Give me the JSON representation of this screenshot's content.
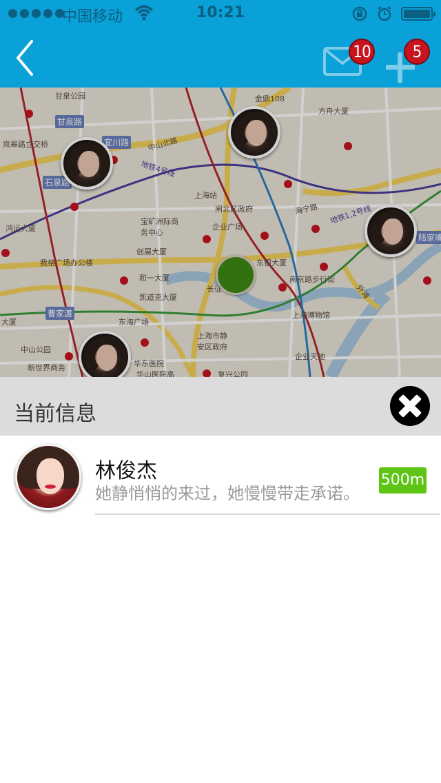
{
  "status_bar": {
    "carrier": "中国移动",
    "time": "10:21"
  },
  "nav": {
    "mail_badge": "10",
    "add_badge": "5"
  },
  "map": {
    "labels": [
      {
        "text": "甘泉公园",
        "boxed": false
      },
      {
        "text": "金鼎108",
        "boxed": false
      },
      {
        "text": "方舟大厦",
        "boxed": false
      },
      {
        "text": "甘泉路",
        "boxed": true
      },
      {
        "text": "宜川路",
        "boxed": true
      },
      {
        "text": "岚皋路立交桥",
        "boxed": false
      },
      {
        "text": "中山北路",
        "boxed": false
      },
      {
        "text": "石泉路",
        "boxed": true
      },
      {
        "text": "上海站",
        "boxed": false
      },
      {
        "text": "闸北区政府",
        "boxed": false
      },
      {
        "text": "海宁路",
        "boxed": false
      },
      {
        "text": "宝矿洲际商务中心",
        "boxed": false
      },
      {
        "text": "企业广场",
        "boxed": false
      },
      {
        "text": "陆家嘴",
        "boxed": true
      },
      {
        "text": "鸿运大厦",
        "boxed": false
      },
      {
        "text": "创展大厦",
        "boxed": false
      },
      {
        "text": "我格广场办公楼",
        "boxed": false
      },
      {
        "text": "东银大厦",
        "boxed": false
      },
      {
        "text": "和一大厦",
        "boxed": false
      },
      {
        "text": "南京路步行街",
        "boxed": false
      },
      {
        "text": "凯道克大厦",
        "boxed": false
      },
      {
        "text": "曹家渡",
        "boxed": true
      },
      {
        "text": "东海广场",
        "boxed": false
      },
      {
        "text": "上海博物馆",
        "boxed": false
      },
      {
        "text": "上海市静安区政府",
        "boxed": false
      },
      {
        "text": "中山公园",
        "boxed": false
      },
      {
        "text": "企业天地",
        "boxed": false
      },
      {
        "text": "新世界商务",
        "boxed": false
      },
      {
        "text": "华东医院",
        "boxed": false
      },
      {
        "text": "华山医院高",
        "boxed": false
      },
      {
        "text": "复兴公园",
        "boxed": false
      },
      {
        "text": "地铁4号线",
        "boxed": false
      },
      {
        "text": "地铁1,2号线",
        "boxed": false
      },
      {
        "text": "长征",
        "boxed": false
      },
      {
        "text": "大厦",
        "boxed": false
      },
      {
        "text": "外滩",
        "boxed": false
      }
    ]
  },
  "info_panel": {
    "title": "当前信息",
    "items": [
      {
        "name": "林俊杰",
        "description": "她静悄悄的来过，她慢慢带走承诺。",
        "distance": "500m"
      }
    ]
  },
  "colors": {
    "nav_blue": "#0aa0d8",
    "badge_red": "#c8141f",
    "distance_green": "#5ec416",
    "location_green": "#3f8a14"
  }
}
